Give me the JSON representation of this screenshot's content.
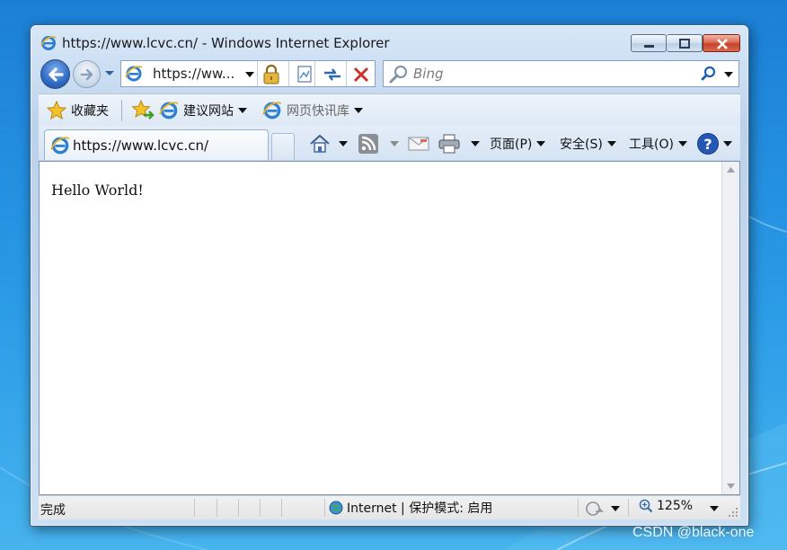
{
  "window": {
    "title": "https://www.lcvc.cn/ - Windows Internet Explorer"
  },
  "address_bar": {
    "url": "https://ww..."
  },
  "search": {
    "placeholder": "Bing"
  },
  "favorites_bar": {
    "favorites_label": "收藏夹",
    "items": [
      {
        "label": "建议网站",
        "icon": "ie-icon"
      },
      {
        "label": "网页快讯库",
        "icon": "ie-icon"
      }
    ]
  },
  "tab": {
    "title": "https://www.lcvc.cn/"
  },
  "command_bar": {
    "page": "页面(P)",
    "safety": "安全(S)",
    "tools": "工具(O)"
  },
  "content": {
    "text": "Hello World!"
  },
  "status_bar": {
    "status": "完成",
    "zone": "Internet | 保护模式: 启用",
    "zoom": "125%"
  },
  "watermark": "CSDN @black-one",
  "colors": {
    "desktop": "#2a9be6",
    "close_button": "#c7412a",
    "nav_back": "#2f6ac4"
  }
}
